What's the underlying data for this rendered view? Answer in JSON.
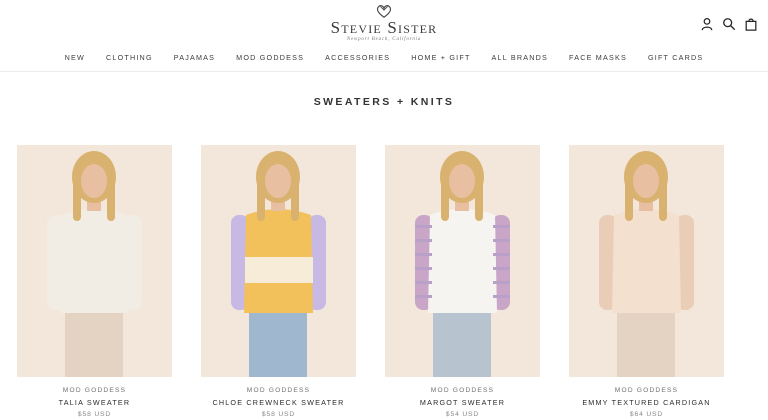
{
  "logo": {
    "title": "Stevie Sister",
    "subtitle": "Newport Beach, California",
    "mark_icon": "heart-bow-icon"
  },
  "header_icons": [
    {
      "name": "account-icon"
    },
    {
      "name": "search-icon"
    },
    {
      "name": "cart-icon"
    }
  ],
  "nav": {
    "items": [
      "New",
      "Clothing",
      "Pajamas",
      "Mod Goddess",
      "Accessories",
      "Home + Gift",
      "All Brands",
      "Face Masks",
      "Gift Cards"
    ]
  },
  "page": {
    "title": "Sweaters + Knits"
  },
  "products": [
    {
      "brand": "Mod Goddess",
      "name": "Talia Sweater",
      "price": "$58 USD",
      "sweater_color": "#f1ece4",
      "accent_color": "#f1ece4"
    },
    {
      "brand": "Mod Goddess",
      "name": "Chloe Crewneck Sweater",
      "price": "$58 USD",
      "sweater_color": "#f2c15c",
      "accent_color": "#c7b8e4"
    },
    {
      "brand": "Mod Goddess",
      "name": "Margot Sweater",
      "price": "$54 USD",
      "sweater_color": "#f6f4f1",
      "accent_color": "#c9a6c8"
    },
    {
      "brand": "Mod Goddess",
      "name": "Emmy Textured Cardigan",
      "price": "$64 USD",
      "sweater_color": "#f3e0cf",
      "accent_color": "#e9cdb7"
    }
  ],
  "colors": {
    "background": "#ffffff",
    "photo_bg": "#f3e7dc",
    "skin": "#e9bfa1",
    "hair": "#d9b26f"
  }
}
